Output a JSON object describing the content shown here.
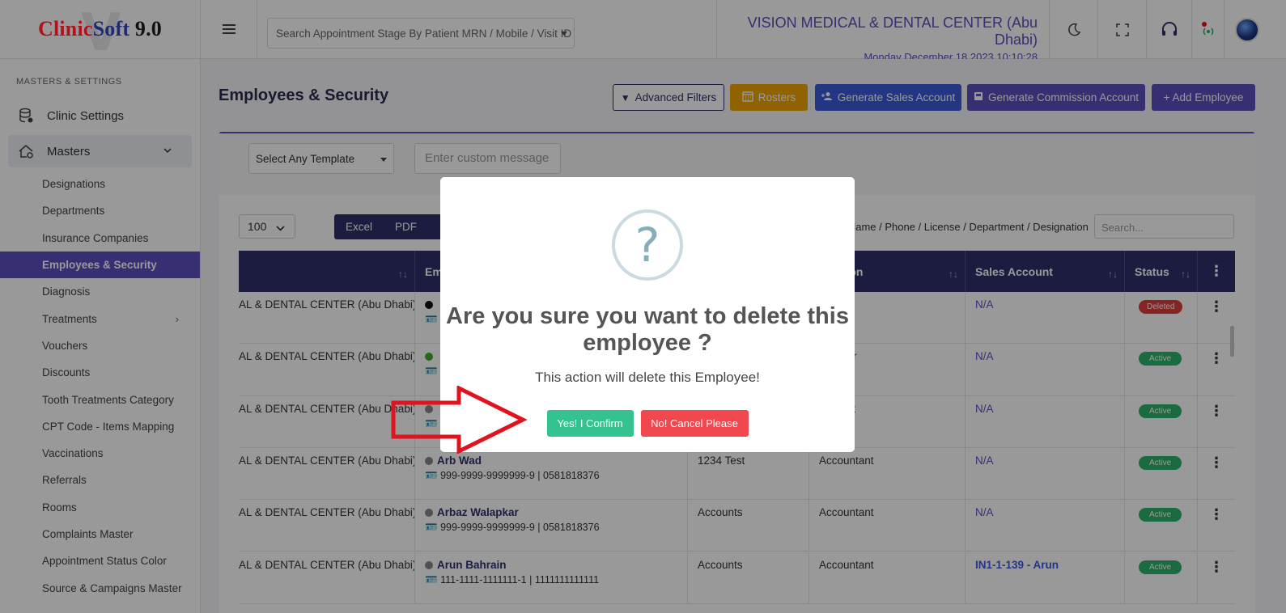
{
  "logo": {
    "part1": "Clinic",
    "part2": "Soft",
    "part3": " 9.0",
    "watermark": "V"
  },
  "sidebar": {
    "heading": "MASTERS & SETTINGS",
    "clinic_settings": "Clinic Settings",
    "masters": "Masters",
    "items": [
      {
        "label": "Designations"
      },
      {
        "label": "Departments"
      },
      {
        "label": "Insurance Companies"
      },
      {
        "label": "Employees & Security",
        "active": true
      },
      {
        "label": "Diagnosis"
      },
      {
        "label": "Treatments",
        "has_submenu": true
      },
      {
        "label": "Vouchers"
      },
      {
        "label": "Discounts"
      },
      {
        "label": "Tooth Treatments Category"
      },
      {
        "label": "CPT Code - Items Mapping"
      },
      {
        "label": "Vaccinations"
      },
      {
        "label": "Referrals"
      },
      {
        "label": "Rooms"
      },
      {
        "label": "Complaints Master"
      },
      {
        "label": "Appointment Status Color"
      },
      {
        "label": "Source & Campaigns Master"
      }
    ]
  },
  "topbar": {
    "search_placeholder": "Search Appointment Stage By Patient MRN / Mobile / Visit ID",
    "clinic_name": "VISION MEDICAL & DENTAL CENTER (Abu Dhabi)",
    "datetime": "Monday December 18 2023 10:10:28"
  },
  "page": {
    "title": "Employees & Security",
    "buttons": {
      "advanced_filters": "Advanced Filters",
      "rosters": "Rosters",
      "generate_sales": "Generate Sales Account",
      "generate_commission": "Generate Commission Account",
      "add_employee": "+ Add Employee"
    },
    "template_select": "Select Any Template",
    "custom_message_placeholder": "Enter custom message",
    "page_size": "100",
    "exports": [
      "Excel",
      "PDF"
    ],
    "search_label": "e Name / Phone / License / Department / Designation",
    "search_placeholder": "Search..."
  },
  "table": {
    "headers": [
      "",
      "Em",
      "",
      "ignation",
      "Sales Account",
      "Status"
    ],
    "rows": [
      {
        "clinic": "AL & DENTAL CENTER (Abu Dhabi)",
        "dot": "black",
        "name": "",
        "meta": "",
        "department": "",
        "designation": "ptionist",
        "sales": "N/A",
        "status": "Deleted"
      },
      {
        "clinic": "AL & DENTAL CENTER (Abu Dhabi)",
        "dot": "green",
        "name": "",
        "meta": "",
        "department": "",
        "designation": "rammer",
        "sales": "N/A",
        "status": "Active"
      },
      {
        "clinic": "AL & DENTAL CENTER (Abu Dhabi)",
        "dot": "grey",
        "name": "",
        "meta": "",
        "department": "",
        "designation": "ountant",
        "sales": "N/A",
        "status": "Active"
      },
      {
        "clinic": "AL & DENTAL CENTER (Abu Dhabi)",
        "dot": "grey",
        "name": "Arb Wad",
        "meta": "999-9999-9999999-9 | 0581818376",
        "department": "1234 Test",
        "designation": "Accountant",
        "sales": "N/A",
        "status": "Active"
      },
      {
        "clinic": "AL & DENTAL CENTER (Abu Dhabi)",
        "dot": "grey",
        "name": "Arbaz Walapkar",
        "meta": "999-9999-9999999-9 | 0581818376",
        "department": "Accounts",
        "designation": "Accountant",
        "sales": "N/A",
        "status": "Active"
      },
      {
        "clinic": "AL & DENTAL CENTER (Abu Dhabi)",
        "dot": "grey",
        "name": "Arun Bahrain",
        "meta": "111-1111-1111111-1 | 1111111111111",
        "department": "Accounts",
        "designation": "Accountant",
        "sales": "IN1-1-139 - Arun",
        "status": "Active"
      }
    ]
  },
  "modal": {
    "icon": "?",
    "title": "Are you sure you want to delete this employee ?",
    "text": "This action will delete this Employee!",
    "confirm": "Yes! I Confirm",
    "cancel": "No! Cancel Please"
  },
  "colors": {
    "brand_purple": "#5a4fbf",
    "navy": "#2d2f6b",
    "confirm_green": "#34c38f",
    "cancel_red": "#f1474f",
    "annotation_arrow": "#e0141e"
  }
}
